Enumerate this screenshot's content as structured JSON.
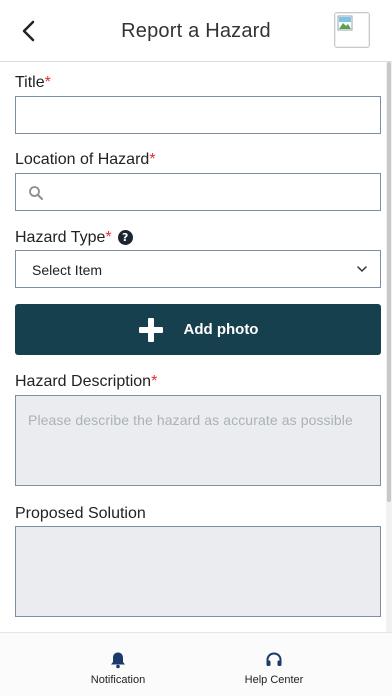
{
  "header": {
    "title": "Report a Hazard",
    "back_icon": "chevron-left-icon",
    "avatar_icon": "broken-image-icon"
  },
  "form": {
    "title_label": "Title",
    "location_label": "Location of Hazard",
    "hazard_type_label": "Hazard Type",
    "hazard_type_value": "Select Item",
    "add_photo_label": "Add photo",
    "description_label": "Hazard Description",
    "description_placeholder": "Please describe the hazard as accurate as possible",
    "solution_label": "Proposed Solution",
    "required_marker": "*",
    "help_marker": "?"
  },
  "bottom_nav": {
    "items": [
      {
        "label": "Notification",
        "icon": "bell-icon"
      },
      {
        "label": "Help Center",
        "icon": "headphones-icon"
      }
    ]
  },
  "colors": {
    "primary": "#17404e",
    "required": "#e03030",
    "nav_icon": "#1b3a6b",
    "field_border": "#7e8fa4"
  }
}
